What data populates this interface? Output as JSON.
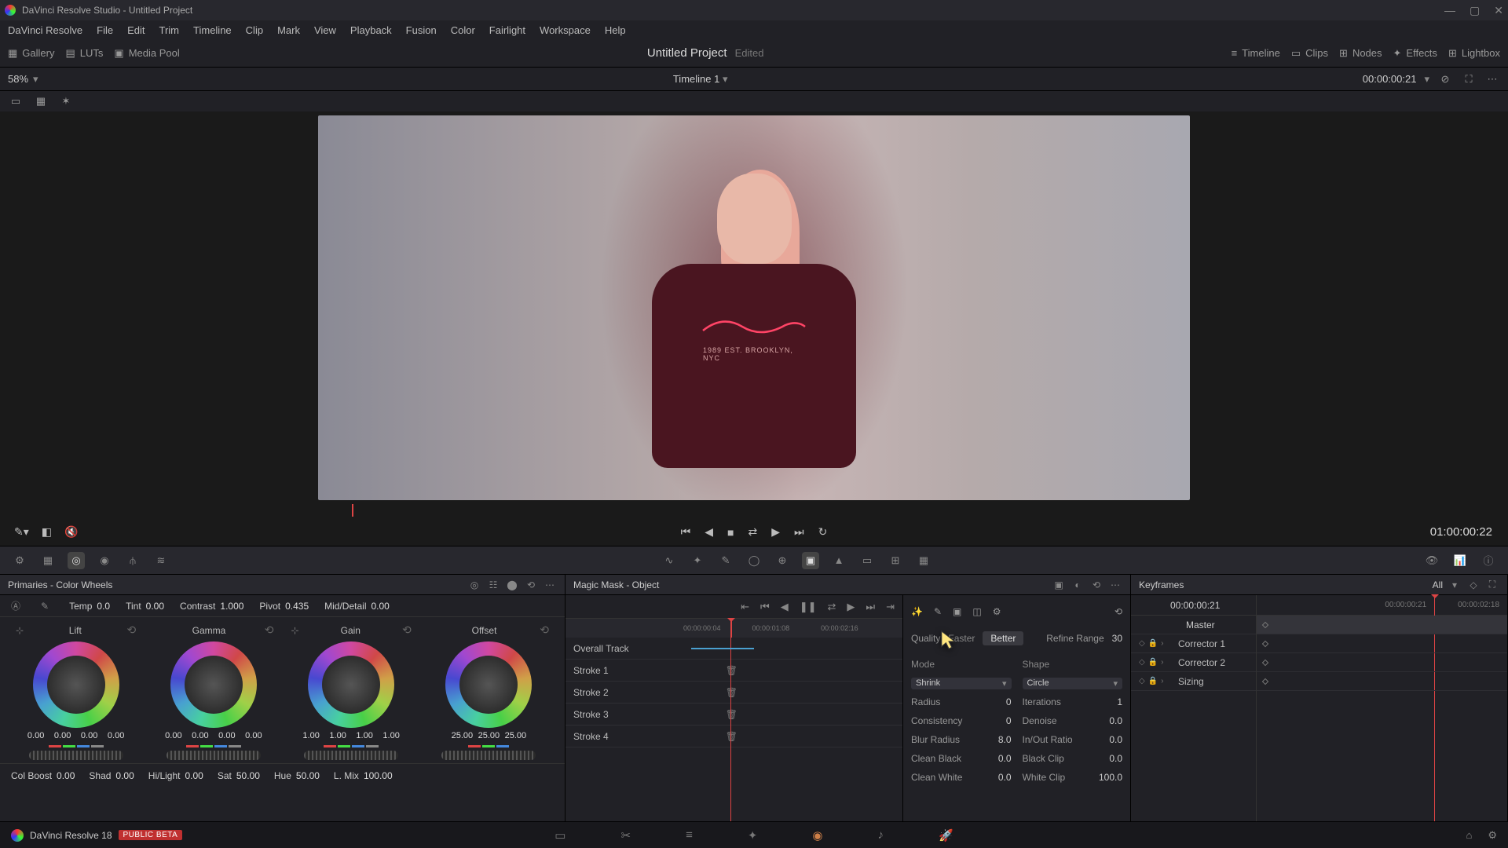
{
  "title": "DaVinci Resolve Studio - Untitled Project",
  "menus": [
    "DaVinci Resolve",
    "File",
    "Edit",
    "Trim",
    "Timeline",
    "Clip",
    "Mark",
    "View",
    "Playback",
    "Fusion",
    "Color",
    "Fairlight",
    "Workspace",
    "Help"
  ],
  "toolbar": {
    "gallery": "Gallery",
    "luts": "LUTs",
    "mediapool": "Media Pool",
    "project": "Untitled Project",
    "edited": "Edited",
    "timeline": "Timeline",
    "clips": "Clips",
    "nodes": "Nodes",
    "effects": "Effects",
    "lightbox": "Lightbox"
  },
  "zoom": "58%",
  "timeline_name": "Timeline 1",
  "viewer_tc": "00:00:00:21",
  "shirt_text": "1989 EST. BROOKLYN, NYC",
  "transport_tc": "01:00:00:22",
  "primaries": {
    "title": "Primaries - Color Wheels",
    "top": {
      "temp_l": "Temp",
      "temp": "0.0",
      "tint_l": "Tint",
      "tint": "0.00",
      "contrast_l": "Contrast",
      "contrast": "1.000",
      "pivot_l": "Pivot",
      "pivot": "0.435",
      "md_l": "Mid/Detail",
      "md": "0.00"
    },
    "wheels": {
      "lift": {
        "name": "Lift",
        "v": [
          "0.00",
          "0.00",
          "0.00",
          "0.00"
        ]
      },
      "gamma": {
        "name": "Gamma",
        "v": [
          "0.00",
          "0.00",
          "0.00",
          "0.00"
        ]
      },
      "gain": {
        "name": "Gain",
        "v": [
          "1.00",
          "1.00",
          "1.00",
          "1.00"
        ]
      },
      "offset": {
        "name": "Offset",
        "v": [
          "25.00",
          "25.00",
          "25.00"
        ]
      }
    },
    "bot": {
      "colboost_l": "Col Boost",
      "colboost": "0.00",
      "shad_l": "Shad",
      "shad": "0.00",
      "hl_l": "Hi/Light",
      "hl": "0.00",
      "sat_l": "Sat",
      "sat": "50.00",
      "hue_l": "Hue",
      "hue": "50.00",
      "lmix_l": "L. Mix",
      "lmix": "100.00"
    }
  },
  "mask": {
    "title": "Magic Mask - Object",
    "ruler": [
      "00:00:00:04",
      "00:00:01:08",
      "00:00:02:16"
    ],
    "rows": {
      "overall": "Overall Track",
      "s1": "Stroke 1",
      "s2": "Stroke 2",
      "s3": "Stroke 3",
      "s4": "Stroke 4"
    },
    "quality_l": "Quality",
    "faster": "Faster",
    "better": "Better",
    "refine_l": "Refine Range",
    "refine": "30",
    "mode_l": "Mode",
    "shape_l": "Shape",
    "shrink": "Shrink",
    "circle": "Circle",
    "radius_l": "Radius",
    "radius": "0",
    "iter_l": "Iterations",
    "iter": "1",
    "cons_l": "Consistency",
    "cons": "0",
    "den_l": "Denoise",
    "den": "0.0",
    "blur_l": "Blur Radius",
    "blur": "8.0",
    "io_l": "In/Out Ratio",
    "io": "0.0",
    "cb_l": "Clean Black",
    "cb": "0.0",
    "bc_l": "Black Clip",
    "bc": "0.0",
    "cw_l": "Clean White",
    "cw": "0.0",
    "wc_l": "White Clip",
    "wc": "100.0"
  },
  "keyframes": {
    "title": "Keyframes",
    "all": "All",
    "tc": "00:00:00:21",
    "ruler": [
      "00:00:00:21",
      "00:00:02:18"
    ],
    "master": "Master",
    "rows": [
      "Corrector 1",
      "Corrector 2",
      "Sizing"
    ]
  },
  "footer": {
    "brand": "DaVinci Resolve 18",
    "beta": "PUBLIC BETA"
  }
}
